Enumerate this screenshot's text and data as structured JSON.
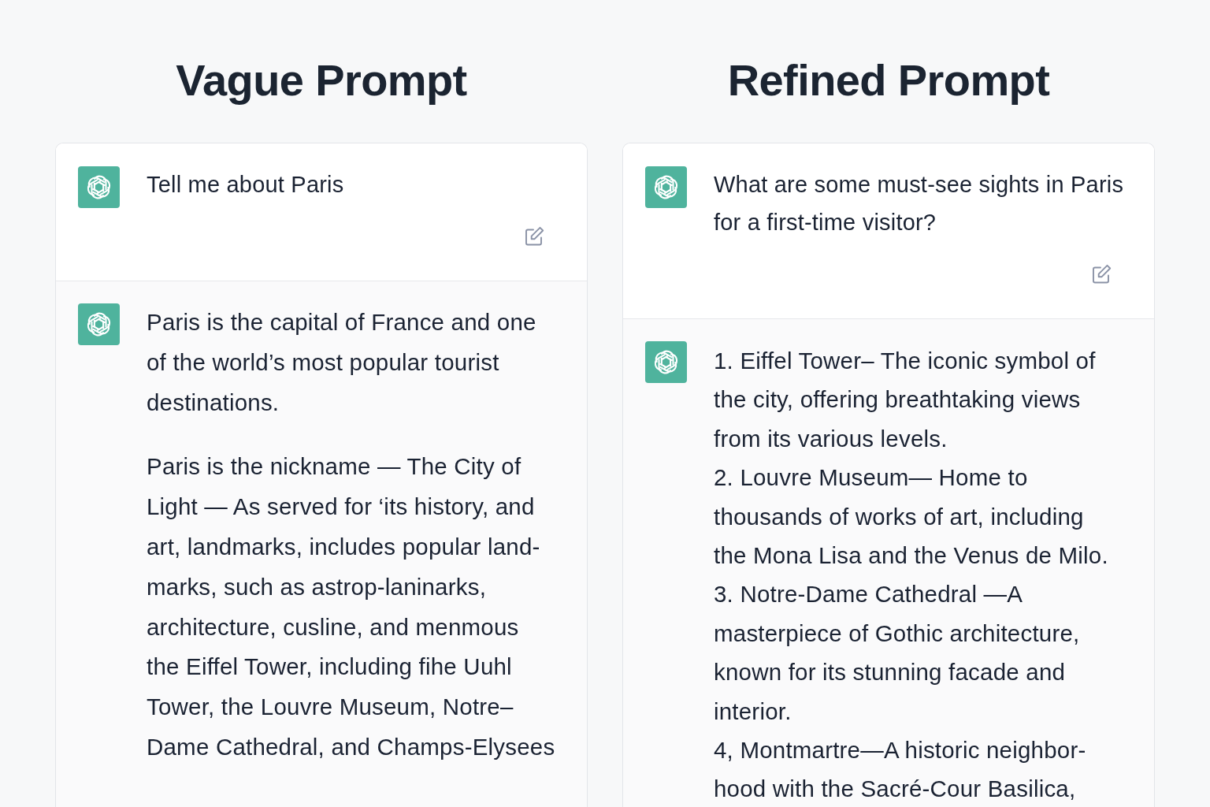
{
  "panels": [
    {
      "heading": "Vague Prompt",
      "prompt": {
        "text": "Tell me about Paris"
      },
      "response": {
        "kind": "paragraphs",
        "blocks": [
          "Paris is the capital of France and one of the world’s most popular tourist destinations.",
          "Paris is the nickname — The City of Light — As served for ‘its history, and art, landmarks, includes popular land-marks, such as astrop-laninarks, architecture, cusline, and menmous the Eiffel Tower, including fihe Uuhl Tower, the Louvre Museum, Notre–Dame Cathedral, and Champs-Elysees"
        ]
      }
    },
    {
      "heading": "Refined Prompt",
      "prompt": {
        "text": "What are some must-see sights in Paris for a first-time visitor?"
      },
      "response": {
        "kind": "list",
        "blocks": [
          "1. Eiffel Tower– The iconic symbol of the city, offering breathtaking views from its various levels.",
          "2. Louvre Museum— Home to thousands of works of art, including the Mona Lisa and the Venus de Milo.",
          "3. Notre-Dame Cathedral —A masterpiece of Gothic architecture, known for its stunning facade and interior.",
          "4, Montmartre—A historic neighbor-hood with the Sacré-Cour Basilica,"
        ]
      }
    }
  ]
}
